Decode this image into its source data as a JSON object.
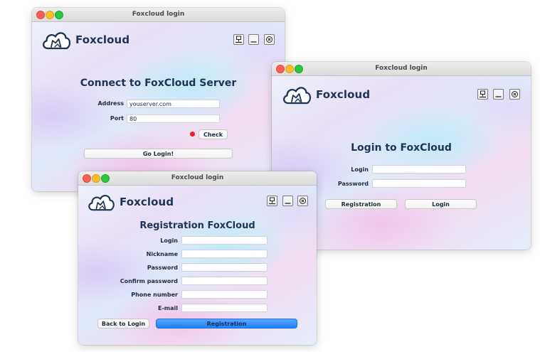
{
  "brand": {
    "name": "Foxcloud",
    "logo_color": "#1c3455"
  },
  "colors": {
    "primary_button": "#1d80f5",
    "status_error": "#f0201c",
    "title_text": "#1c3455"
  },
  "windows": {
    "connect": {
      "title": "Foxcloud login",
      "heading": "Connect to FoxCloud Server",
      "address_label": "Address",
      "address_value": "youserver.com",
      "port_label": "Port",
      "port_value": "80",
      "check_label": "Check",
      "go_login_label": "Go Login!"
    },
    "login": {
      "title": "Foxcloud login",
      "heading": "Login to FoxCloud",
      "login_label": "Login",
      "login_value": "",
      "password_label": "Password",
      "password_value": "",
      "registration_label": "Registration",
      "login_button_label": "Login"
    },
    "registration": {
      "title": "Foxcloud login",
      "heading": "Registration FoxCloud",
      "fields": [
        {
          "label": "Login",
          "value": ""
        },
        {
          "label": "Nickname",
          "value": ""
        },
        {
          "label": "Password",
          "value": ""
        },
        {
          "label": "Confirm password",
          "value": ""
        },
        {
          "label": "Phone number",
          "value": ""
        },
        {
          "label": "E-mail",
          "value": ""
        }
      ],
      "back_label": "Back to Login",
      "registration_label": "Registration"
    }
  },
  "icons": [
    "cloud-fox-logo-icon",
    "network-icon",
    "minimize-icon",
    "close-circle-icon"
  ]
}
